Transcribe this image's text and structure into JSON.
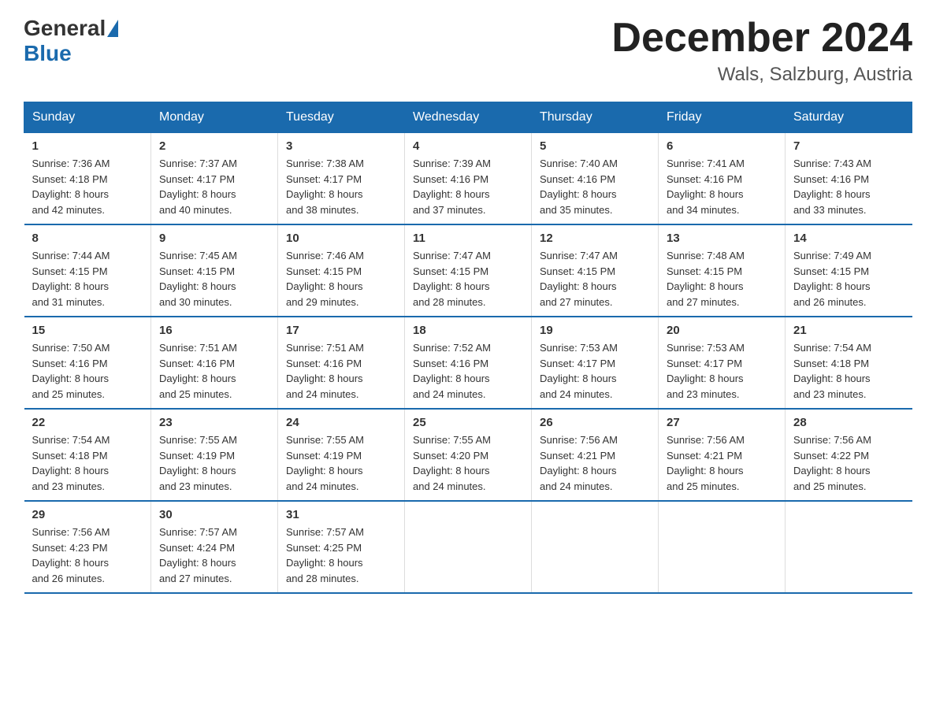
{
  "header": {
    "logo": {
      "general": "General",
      "blue": "Blue"
    },
    "title": "December 2024",
    "location": "Wals, Salzburg, Austria"
  },
  "days_of_week": [
    "Sunday",
    "Monday",
    "Tuesday",
    "Wednesday",
    "Thursday",
    "Friday",
    "Saturday"
  ],
  "weeks": [
    [
      {
        "day": "1",
        "sunrise": "7:36 AM",
        "sunset": "4:18 PM",
        "daylight": "8 hours and 42 minutes."
      },
      {
        "day": "2",
        "sunrise": "7:37 AM",
        "sunset": "4:17 PM",
        "daylight": "8 hours and 40 minutes."
      },
      {
        "day": "3",
        "sunrise": "7:38 AM",
        "sunset": "4:17 PM",
        "daylight": "8 hours and 38 minutes."
      },
      {
        "day": "4",
        "sunrise": "7:39 AM",
        "sunset": "4:16 PM",
        "daylight": "8 hours and 37 minutes."
      },
      {
        "day": "5",
        "sunrise": "7:40 AM",
        "sunset": "4:16 PM",
        "daylight": "8 hours and 35 minutes."
      },
      {
        "day": "6",
        "sunrise": "7:41 AM",
        "sunset": "4:16 PM",
        "daylight": "8 hours and 34 minutes."
      },
      {
        "day": "7",
        "sunrise": "7:43 AM",
        "sunset": "4:16 PM",
        "daylight": "8 hours and 33 minutes."
      }
    ],
    [
      {
        "day": "8",
        "sunrise": "7:44 AM",
        "sunset": "4:15 PM",
        "daylight": "8 hours and 31 minutes."
      },
      {
        "day": "9",
        "sunrise": "7:45 AM",
        "sunset": "4:15 PM",
        "daylight": "8 hours and 30 minutes."
      },
      {
        "day": "10",
        "sunrise": "7:46 AM",
        "sunset": "4:15 PM",
        "daylight": "8 hours and 29 minutes."
      },
      {
        "day": "11",
        "sunrise": "7:47 AM",
        "sunset": "4:15 PM",
        "daylight": "8 hours and 28 minutes."
      },
      {
        "day": "12",
        "sunrise": "7:47 AM",
        "sunset": "4:15 PM",
        "daylight": "8 hours and 27 minutes."
      },
      {
        "day": "13",
        "sunrise": "7:48 AM",
        "sunset": "4:15 PM",
        "daylight": "8 hours and 27 minutes."
      },
      {
        "day": "14",
        "sunrise": "7:49 AM",
        "sunset": "4:15 PM",
        "daylight": "8 hours and 26 minutes."
      }
    ],
    [
      {
        "day": "15",
        "sunrise": "7:50 AM",
        "sunset": "4:16 PM",
        "daylight": "8 hours and 25 minutes."
      },
      {
        "day": "16",
        "sunrise": "7:51 AM",
        "sunset": "4:16 PM",
        "daylight": "8 hours and 25 minutes."
      },
      {
        "day": "17",
        "sunrise": "7:51 AM",
        "sunset": "4:16 PM",
        "daylight": "8 hours and 24 minutes."
      },
      {
        "day": "18",
        "sunrise": "7:52 AM",
        "sunset": "4:16 PM",
        "daylight": "8 hours and 24 minutes."
      },
      {
        "day": "19",
        "sunrise": "7:53 AM",
        "sunset": "4:17 PM",
        "daylight": "8 hours and 24 minutes."
      },
      {
        "day": "20",
        "sunrise": "7:53 AM",
        "sunset": "4:17 PM",
        "daylight": "8 hours and 23 minutes."
      },
      {
        "day": "21",
        "sunrise": "7:54 AM",
        "sunset": "4:18 PM",
        "daylight": "8 hours and 23 minutes."
      }
    ],
    [
      {
        "day": "22",
        "sunrise": "7:54 AM",
        "sunset": "4:18 PM",
        "daylight": "8 hours and 23 minutes."
      },
      {
        "day": "23",
        "sunrise": "7:55 AM",
        "sunset": "4:19 PM",
        "daylight": "8 hours and 23 minutes."
      },
      {
        "day": "24",
        "sunrise": "7:55 AM",
        "sunset": "4:19 PM",
        "daylight": "8 hours and 24 minutes."
      },
      {
        "day": "25",
        "sunrise": "7:55 AM",
        "sunset": "4:20 PM",
        "daylight": "8 hours and 24 minutes."
      },
      {
        "day": "26",
        "sunrise": "7:56 AM",
        "sunset": "4:21 PM",
        "daylight": "8 hours and 24 minutes."
      },
      {
        "day": "27",
        "sunrise": "7:56 AM",
        "sunset": "4:21 PM",
        "daylight": "8 hours and 25 minutes."
      },
      {
        "day": "28",
        "sunrise": "7:56 AM",
        "sunset": "4:22 PM",
        "daylight": "8 hours and 25 minutes."
      }
    ],
    [
      {
        "day": "29",
        "sunrise": "7:56 AM",
        "sunset": "4:23 PM",
        "daylight": "8 hours and 26 minutes."
      },
      {
        "day": "30",
        "sunrise": "7:57 AM",
        "sunset": "4:24 PM",
        "daylight": "8 hours and 27 minutes."
      },
      {
        "day": "31",
        "sunrise": "7:57 AM",
        "sunset": "4:25 PM",
        "daylight": "8 hours and 28 minutes."
      },
      null,
      null,
      null,
      null
    ]
  ],
  "labels": {
    "sunrise": "Sunrise:",
    "sunset": "Sunset:",
    "daylight": "Daylight:"
  }
}
